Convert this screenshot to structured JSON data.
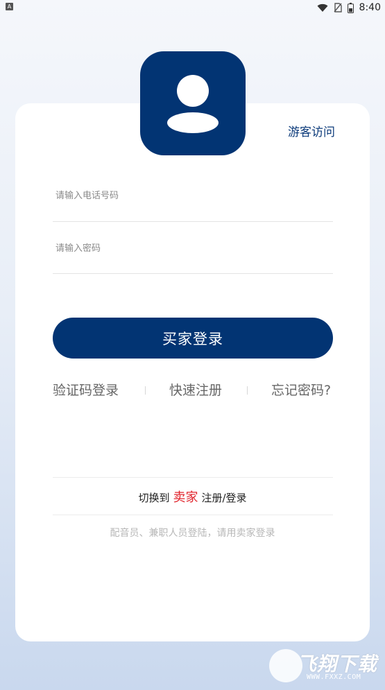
{
  "status_bar": {
    "left_indicator": "A",
    "time": "8:40",
    "icons": [
      "wifi-icon",
      "sim-off-icon",
      "battery-icon"
    ]
  },
  "header": {
    "guest_link": "游客访问",
    "avatar_icon": "user-avatar-icon"
  },
  "form": {
    "phone_placeholder": "请输入电话号码",
    "password_placeholder": "请输入密码",
    "login_button": "买家登录"
  },
  "links": {
    "sms_login": "验证码登录",
    "quick_register": "快速注册",
    "forgot_password": "忘记密码?"
  },
  "switch": {
    "prefix": "切换到",
    "highlight": "卖家",
    "suffix": "注册/登录"
  },
  "note": "配音员、兼职人员登陆，请用卖家登录",
  "watermark": {
    "title": "飞翔下载",
    "url": "WWW.FXXZ.COM"
  },
  "colors": {
    "brand": "#023473",
    "accent_red": "#e0242c"
  }
}
